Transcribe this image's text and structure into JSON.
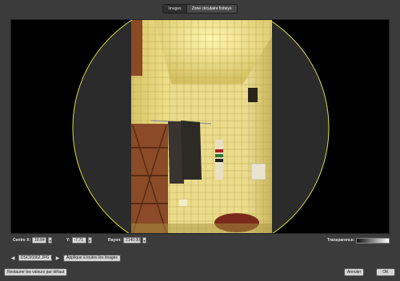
{
  "tabs": [
    {
      "label": "Images",
      "active": false
    },
    {
      "label": "Zone circulaire fisheye",
      "active": true
    }
  ],
  "viewer": {
    "circle_color": "#d8d84a",
    "image_tint": "#e6d27a"
  },
  "controls": {
    "center_x_label": "Centre X:",
    "center_x_value": "18.84",
    "y_label": "Y:",
    "y_value": "-7.71",
    "radius_label": "Rayon:",
    "radius_value": "2140.00",
    "transparency_label": "Transparence:"
  },
  "filebar": {
    "file_name": "DSC00362.JPG",
    "apply_all_label": "Applique à toutes les images"
  },
  "footer": {
    "restore_label": "Restaurer les valeurs par défaut",
    "cancel_label": "Annuler",
    "ok_label": "OK"
  }
}
